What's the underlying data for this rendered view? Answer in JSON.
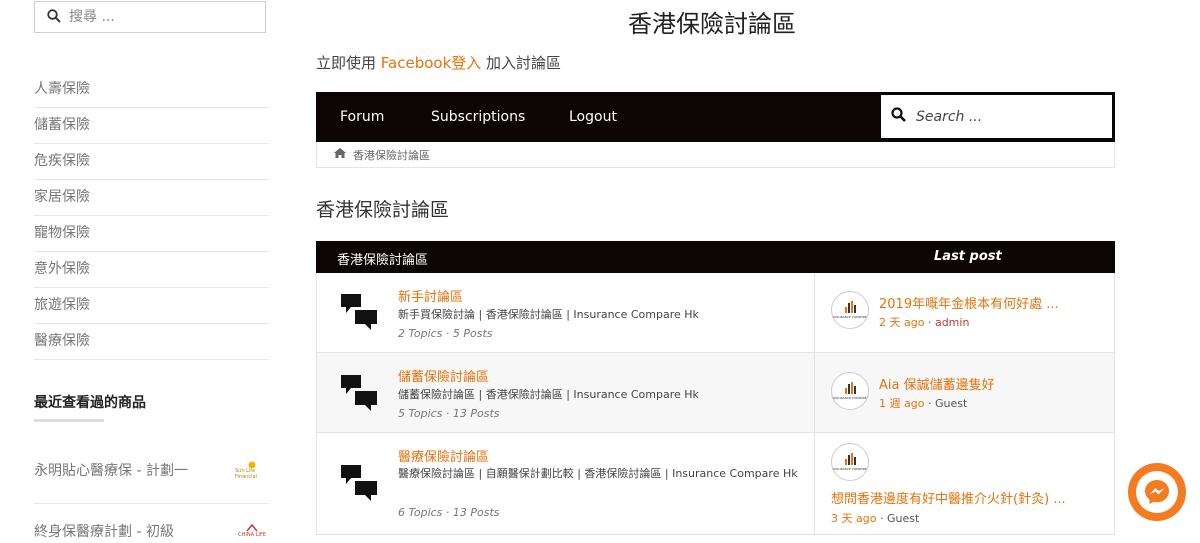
{
  "sidebar": {
    "search_placeholder": "搜尋 ...",
    "categories": [
      "人壽保險",
      "儲蓄保險",
      "危疾保險",
      "家居保險",
      "寵物保險",
      "意外保險",
      "旅遊保險",
      "醫療保險"
    ],
    "recent_title": "最近查看過的商品",
    "recent_items": [
      {
        "label": "永明貼心醫療保 - 計劃一",
        "logo_text": "Sun Life Financial"
      },
      {
        "label": "終身保醫療計劃 - 初級",
        "logo_text": "CHINA LIFE"
      }
    ]
  },
  "header": {
    "site_title": "香港保險討論區",
    "login_prefix": "立即使用 ",
    "login_link": "Facebook登入",
    "login_suffix": " 加入討論區"
  },
  "nav": {
    "links": [
      "Forum",
      "Subscriptions",
      "Logout"
    ],
    "search_placeholder": "Search ..."
  },
  "breadcrumb": {
    "label": "香港保險討論區"
  },
  "forum": {
    "heading": "香港保險討論區",
    "col_forum": "香港保險討論區",
    "col_last_post": "Last post",
    "rows": [
      {
        "name": "新手討論區",
        "desc": "新手買保險討論 | 香港保險討論區 | Insurance Compare Hk",
        "stats": "2 Topics · 5 Posts",
        "last_title": "2019年嘅年金根本有何好處 ...",
        "last_time": "2 天 ago",
        "last_sep": " · ",
        "last_user": "admin"
      },
      {
        "name": "儲蓄保險討論區",
        "desc": "儲蓄保險討論區 | 香港保險討論區 | Insurance Compare Hk",
        "stats": "5 Topics · 13 Posts",
        "last_title": "Aia 保誠儲蓄邊隻好",
        "last_time": "1 週 ago",
        "last_sep": " · ",
        "last_user": "Guest"
      },
      {
        "name": "醫療保險討論區",
        "desc": "醫療保險討論區 | 自願醫保計劃比較 | 香港保險討論區 | Insurance Compare Hk",
        "stats": "6 Topics · 13 Posts",
        "last_title": "想問香港邊度有好中醫推介火針(針灸) ...",
        "last_time": "3 天 ago",
        "last_sep": " · ",
        "last_user": "Guest"
      }
    ]
  },
  "avatar_text": "INSURANCE COMPARE",
  "colors": {
    "accent": "#e8720c",
    "navbar": "#0b0506",
    "messenger": "#f47b20"
  },
  "icons": [
    "search-icon",
    "home-icon",
    "forum-bubble-icon",
    "messenger-icon"
  ]
}
